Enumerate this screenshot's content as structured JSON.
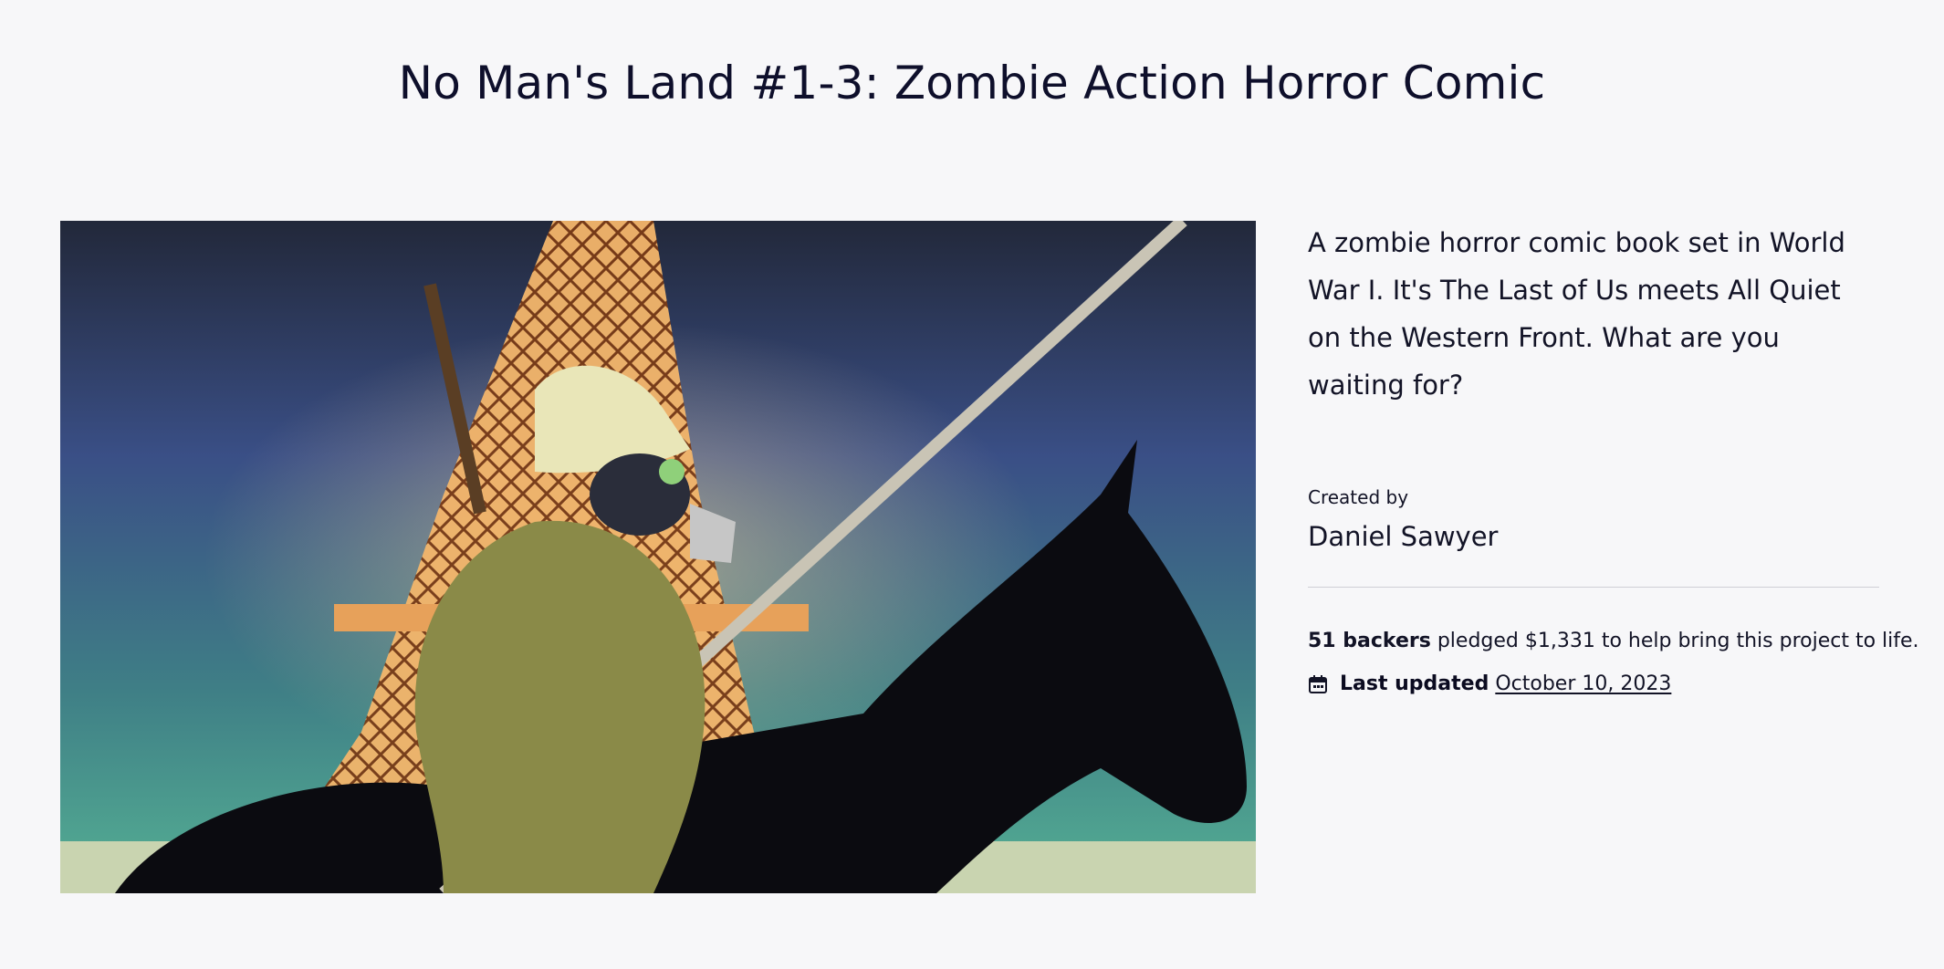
{
  "project": {
    "title": "No Man's Land #1-3: Zombie Action Horror Comic",
    "blurb": "A zombie horror comic book set in World War I. It's The Last of Us meets All Quiet on the Western Front. What are you waiting for?",
    "created_by_label": "Created by",
    "creator_name": "Daniel Sawyer"
  },
  "funding": {
    "backers_label": "51 backers",
    "pledged_text": "pledged $1,331 to help bring this project to life."
  },
  "updated": {
    "label": "Last updated",
    "date": "October 10, 2023",
    "icon": "calendar-icon"
  },
  "colors": {
    "background": "#f7f7f9",
    "text": "#0e0f2b",
    "divider": "#cfcfd5"
  }
}
